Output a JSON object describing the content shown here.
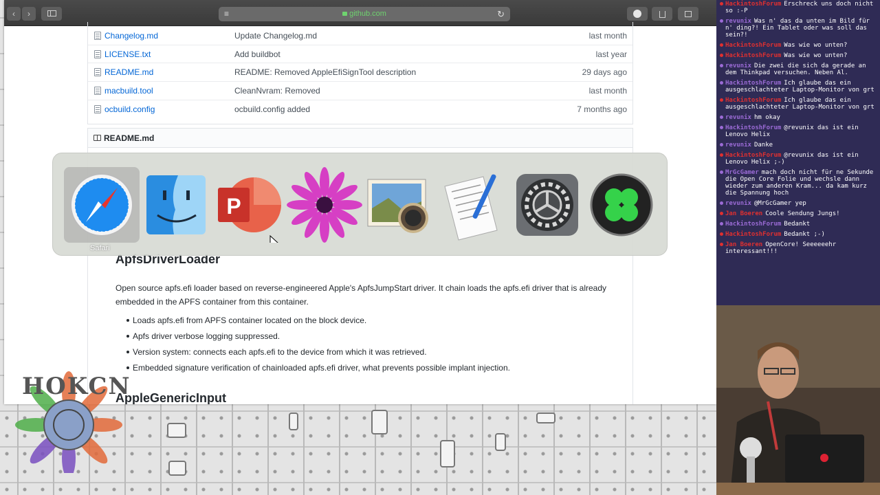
{
  "browser": {
    "url": "github.com",
    "nav_back": "‹",
    "nav_forward": "›"
  },
  "files": [
    {
      "name": "Changelog.md",
      "message": "Update Changelog.md",
      "age": "last month"
    },
    {
      "name": "LICENSE.txt",
      "message": "Add buildbot",
      "age": "last year"
    },
    {
      "name": "README.md",
      "message": "README: Removed AppleEfiSignTool description",
      "age": "29 days ago"
    },
    {
      "name": "macbuild.tool",
      "message": "CleanNvram: Removed",
      "age": "last month"
    },
    {
      "name": "ocbuild.config",
      "message": "ocbuild.config added",
      "age": "7 months ago"
    }
  ],
  "readme": {
    "title": "README.md",
    "section1_heading": "ApfsDriverLoader",
    "section1_para": "Open source apfs.efi loader based on reverse-engineered Apple's ApfsJumpStart driver. It chain loads the apfs.efi driver that is already embedded in the APFS container from this container.",
    "bullets": [
      "Loads apfs.efi from APFS container located on the block device.",
      "Apfs driver verbose logging suppressed.",
      "Version system: connects each apfs.efi to the device from which it was retrieved.",
      "Embedded signature verification of chainloaded apfs.efi driver, what prevents possible implant injection."
    ],
    "section2_heading": "AppleGenericInput"
  },
  "switcher": {
    "apps": [
      {
        "name": "Safari",
        "icon": "safari-icon"
      },
      {
        "name": "Finder",
        "icon": "finder-icon"
      },
      {
        "name": "PowerPoint",
        "icon": "powerpoint-icon"
      },
      {
        "name": "Flower",
        "icon": "flower-app-icon"
      },
      {
        "name": "Preview",
        "icon": "preview-icon"
      },
      {
        "name": "TextEdit",
        "icon": "textedit-icon"
      },
      {
        "name": "System Preferences",
        "icon": "system-preferences-icon"
      },
      {
        "name": "Clover Configurator",
        "icon": "clover-icon"
      }
    ],
    "selected_label": "Safari"
  },
  "chat": {
    "messages": [
      {
        "user": "HackintoshForum",
        "text": "Erschreck uns doch nicht so :-P",
        "color": "#e03030"
      },
      {
        "user": "revunix",
        "text": "Was n' das da unten im Bild für n' ding?! Ein Tablet oder was soll das sein?!",
        "color": "#9b6bd6"
      },
      {
        "user": "HackintoshForum",
        "text": "Was wie wo unten?",
        "color": "#e03030"
      },
      {
        "user": "HackintoshForum",
        "text": "Was wie wo unten?",
        "color": "#e03030"
      },
      {
        "user": "revunix",
        "text": "Die zwei die sich da gerade an dem Thinkpad versuchen. Neben Al.",
        "color": "#9b6bd6"
      },
      {
        "user": "HackintoshForum",
        "text": "Ich glaube das ein ausgeschlachteter Laptop-Monitor von grt",
        "color": "#9b6bd6"
      },
      {
        "user": "HackintoshForum",
        "text": "Ich glaube das ein ausgeschlachteter Laptop-Monitor von grt",
        "color": "#e03030"
      },
      {
        "user": "revunix",
        "text": "hm okay",
        "color": "#9b6bd6"
      },
      {
        "user": "HackintoshForum",
        "text": "@revunix das ist ein Lenovo Helix",
        "color": "#9b6bd6"
      },
      {
        "user": "revunix",
        "text": "Danke",
        "color": "#9b6bd6"
      },
      {
        "user": "HackintoshForum",
        "text": "@revunix das ist ein Lenovo Helix ;-)",
        "color": "#e03030"
      },
      {
        "user": "MrGcGamer",
        "text": "mach doch nicht für ne Sekunde die Open Core Folie und wechsle dann wieder zum anderen Kram... da kam kurz die Spannung hoch",
        "color": "#9b6bd6"
      },
      {
        "user": "revunix",
        "text": "@MrGcGamer yep",
        "color": "#9b6bd6"
      },
      {
        "user": "Jan Boeren",
        "text": "Coole Sendung Jungs!",
        "color": "#e03030"
      },
      {
        "user": "HackintoshForum",
        "text": "Bedankt",
        "color": "#9b6bd6"
      },
      {
        "user": "HackintoshForum",
        "text": "Bedankt ;-)",
        "color": "#e03030"
      },
      {
        "user": "Jan Boeren",
        "text": "OpenCore! Seeeeeehr interessant!!!",
        "color": "#e03030"
      }
    ]
  },
  "logo": {
    "text": "HOKCN"
  }
}
